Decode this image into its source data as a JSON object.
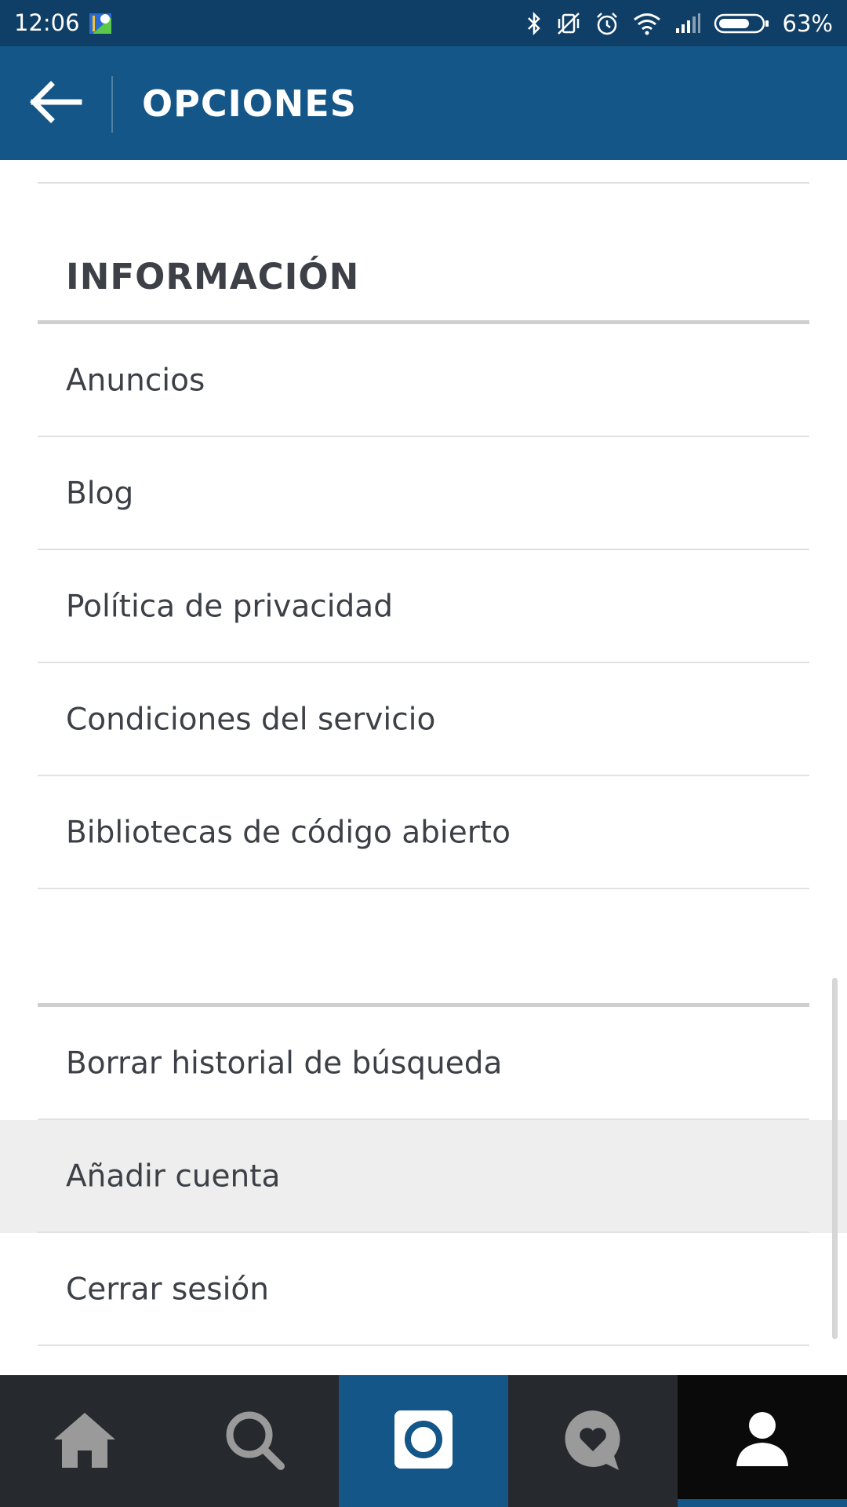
{
  "status_bar": {
    "time": "12:06",
    "battery_percent": "63%",
    "icons": [
      "app-notification-icon",
      "bluetooth-icon",
      "vibrate-off-icon",
      "alarm-icon",
      "wifi-icon",
      "signal-icon",
      "battery-icon"
    ]
  },
  "app_bar": {
    "title": "OPCIONES",
    "back_icon": "arrow-left-icon"
  },
  "section": {
    "title": "INFORMACIÓN",
    "items": [
      {
        "label": "Anuncios"
      },
      {
        "label": "Blog"
      },
      {
        "label": "Política de privacidad"
      },
      {
        "label": "Condiciones del servicio"
      },
      {
        "label": "Bibliotecas de código abierto"
      }
    ]
  },
  "account_actions": [
    {
      "label": "Borrar historial de búsqueda"
    },
    {
      "label": "Añadir cuenta"
    },
    {
      "label": "Cerrar sesión"
    }
  ],
  "bottom_nav": {
    "tabs": [
      "home-icon",
      "search-icon",
      "camera-icon",
      "activity-icon",
      "profile-icon"
    ],
    "active_tab": "profile-icon"
  },
  "colors": {
    "status_bar": "#0f3e66",
    "app_bar": "#135687",
    "nav_bg": "#262a2f",
    "pressed_row": "#edeeed",
    "text": "#3d4147"
  }
}
